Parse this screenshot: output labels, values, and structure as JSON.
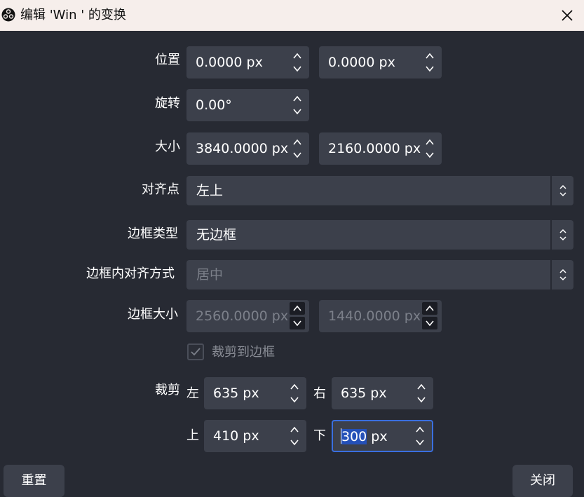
{
  "window": {
    "title": "编辑 'Win ' 的变换",
    "app_icon": "obs-logo-icon",
    "close_icon": "close-icon"
  },
  "position": {
    "label": "位置",
    "x": "0.0000 px",
    "y": "0.0000 px"
  },
  "rotation": {
    "label": "旋转",
    "value": "0.00°"
  },
  "size": {
    "label": "大小",
    "width": "3840.0000 px",
    "height": "2160.0000 px"
  },
  "alignment": {
    "label": "对齐点",
    "value": "左上"
  },
  "bounds_type": {
    "label": "边框类型",
    "value": "无边框"
  },
  "bounds_alignment": {
    "label": "边框内对齐方式",
    "value": "居中"
  },
  "bounds_size": {
    "label": "边框大小",
    "width": "2560.0000 px",
    "height": "1440.0000 px"
  },
  "crop_to_bounds": {
    "label": "裁剪到边框",
    "checked": true
  },
  "crop": {
    "label": "裁剪",
    "left_label": "左",
    "left": "635 px",
    "right_label": "右",
    "right": "635 px",
    "top_label": "上",
    "top": "410 px",
    "bottom_label": "下",
    "bottom_selected": "300",
    "bottom_unit": " px"
  },
  "buttons": {
    "reset": "重置",
    "close": "关闭"
  },
  "colors": {
    "background": "#272a33",
    "field": "#3c404b",
    "titlebar": "#f6eeeb",
    "focus": "#3a6fe0"
  }
}
